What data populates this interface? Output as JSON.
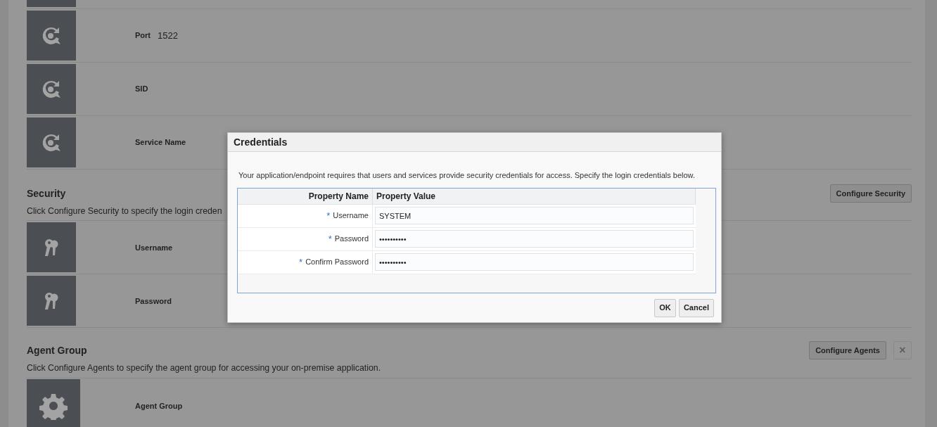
{
  "connection_rows": [
    {
      "kind": "globe"
    },
    {
      "kind": "globe",
      "label": "Port",
      "value": "1522"
    },
    {
      "kind": "globe",
      "label": "SID"
    },
    {
      "kind": "globe",
      "label": "Service Name"
    }
  ],
  "sections": [
    {
      "title": "Security",
      "description": "Click Configure Security to specify the login creden",
      "buttons": [
        {
          "label": "Configure Security",
          "disabled": false
        }
      ],
      "rows": [
        {
          "kind": "keys",
          "label": "Username"
        },
        {
          "kind": "keys",
          "label": "Password"
        }
      ]
    },
    {
      "title": "Agent Group",
      "description": "Click Configure Agents to specify the agent group for accessing your on-premise application.",
      "buttons": [
        {
          "label": "Configure Agents",
          "disabled": false
        },
        {
          "label": "×",
          "disabled": true
        }
      ],
      "rows": [
        {
          "kind": "gear",
          "label": "Agent Group"
        }
      ]
    }
  ],
  "dialog": {
    "title": "Credentials",
    "message": "Your application/endpoint requires that users and services provide security credentials for access. Specify the login credentials below.",
    "columns": [
      "Property Name",
      "Property Value"
    ],
    "fields": [
      {
        "mark": "*",
        "label": "Username",
        "value": "SYSTEM"
      },
      {
        "mark": "*",
        "label": "Password",
        "value": "••••••••••"
      },
      {
        "mark": "*",
        "label": "Confirm Password",
        "value": "••••••••••"
      }
    ],
    "buttons": [
      "OK",
      "Cancel"
    ]
  }
}
